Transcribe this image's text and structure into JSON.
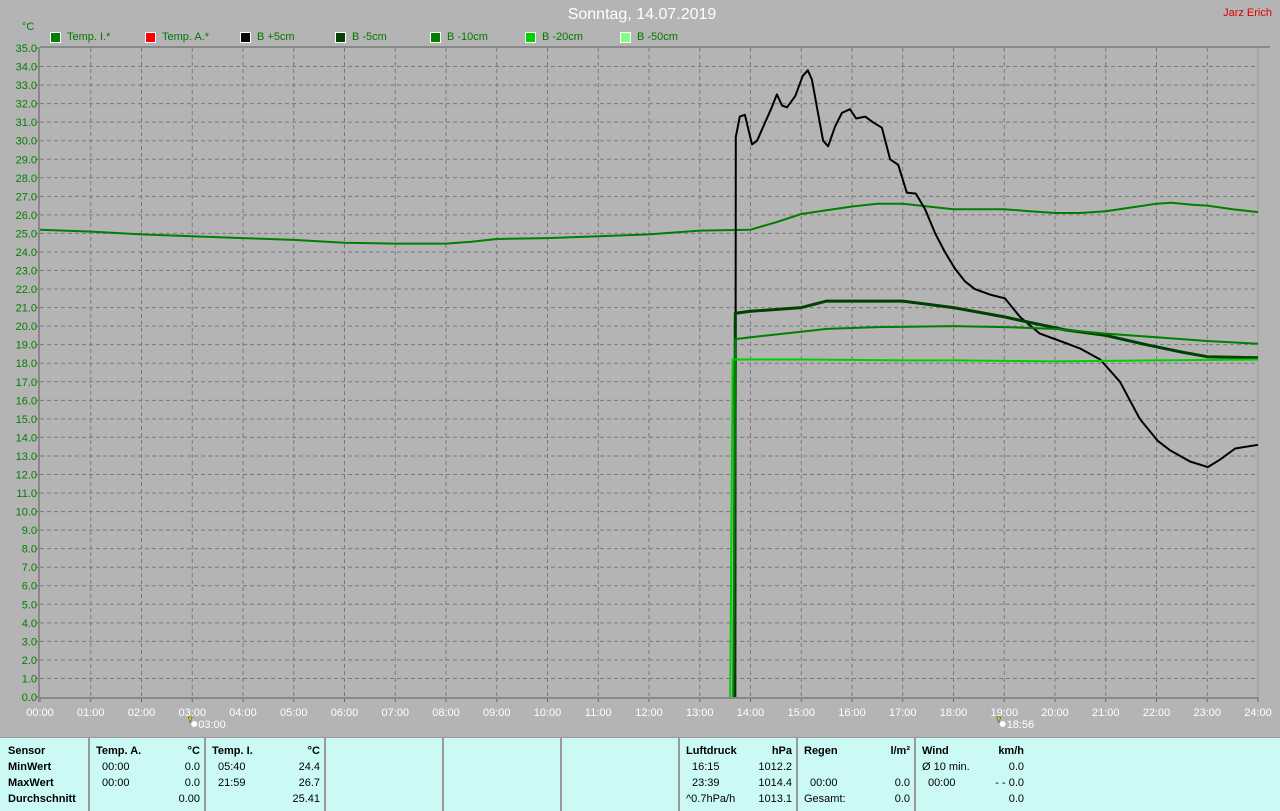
{
  "header": {
    "title": "Sonntag, 14.07.2019",
    "author": "Jarz Erich"
  },
  "legend": [
    {
      "label": "Temp. I.*",
      "color": "#007f00"
    },
    {
      "label": "Temp. A.*",
      "color": "#ff0000"
    },
    {
      "label": "B +5cm",
      "color": "#000000"
    },
    {
      "label": "B -5cm",
      "color": "#004000"
    },
    {
      "label": "B -10cm",
      "color": "#007f00"
    },
    {
      "label": "B -20cm",
      "color": "#00d000"
    },
    {
      "label": "B -50cm",
      "color": "#80ff80"
    }
  ],
  "chart_data": {
    "type": "line",
    "ylabel": "°C",
    "xlim": [
      0,
      24
    ],
    "ylim": [
      0,
      35
    ],
    "grid": true,
    "x_ticks": [
      "00:00",
      "01:00",
      "02:00",
      "03:00",
      "04:00",
      "05:00",
      "06:00",
      "07:00",
      "08:00",
      "09:00",
      "10:00",
      "11:00",
      "12:00",
      "13:00",
      "14:00",
      "15:00",
      "16:00",
      "17:00",
      "18:00",
      "19:00",
      "20:00",
      "21:00",
      "22:00",
      "23:00",
      "24:00"
    ],
    "y_ticks": [
      "0.0",
      "1.0",
      "2.0",
      "3.0",
      "4.0",
      "5.0",
      "6.0",
      "7.0",
      "8.0",
      "9.0",
      "10.0",
      "11.0",
      "12.0",
      "13.0",
      "14.0",
      "15.0",
      "16.0",
      "17.0",
      "18.0",
      "19.0",
      "20.0",
      "21.0",
      "22.0",
      "23.0",
      "24.0",
      "25.0",
      "26.0",
      "27.0",
      "28.0",
      "29.0",
      "30.0",
      "31.0",
      "32.0",
      "33.0",
      "34.0",
      "35.0"
    ],
    "annotations": [
      {
        "label": "03:00",
        "x": 3,
        "icon": "sunrise-icon"
      },
      {
        "label": "18:56",
        "x": 18.93,
        "icon": "sunset-icon"
      }
    ],
    "series": [
      {
        "name": "Temp. I.*",
        "color": "#007f00",
        "x": [
          0,
          1,
          2,
          3,
          4,
          5,
          6,
          7,
          8,
          8.5,
          9,
          10,
          11,
          12,
          13,
          14,
          14.5,
          15,
          15.5,
          16,
          16.5,
          17,
          17.5,
          18,
          18.5,
          19,
          19.5,
          20,
          20.5,
          21,
          21.5,
          22,
          22.3,
          22.7,
          23,
          23.5,
          24
        ],
        "y": [
          25.2,
          25.1,
          24.95,
          24.85,
          24.75,
          24.65,
          24.5,
          24.45,
          24.45,
          24.55,
          24.7,
          24.75,
          24.85,
          24.95,
          25.15,
          25.2,
          25.6,
          26.05,
          26.25,
          26.45,
          26.6,
          26.6,
          26.45,
          26.3,
          26.3,
          26.3,
          26.2,
          26.1,
          26.1,
          26.2,
          26.4,
          26.6,
          26.65,
          26.55,
          26.5,
          26.3,
          26.15
        ]
      },
      {
        "name": "B +5cm",
        "color": "#000000",
        "x": [
          13.7,
          13.71,
          13.79,
          13.89,
          14.03,
          14.13,
          14.29,
          14.42,
          14.52,
          14.62,
          14.72,
          14.88,
          15.03,
          15.13,
          15.21,
          15.33,
          15.43,
          15.53,
          15.67,
          15.8,
          15.96,
          16.08,
          16.26,
          16.41,
          16.59,
          16.75,
          16.91,
          17.08,
          17.26,
          17.44,
          17.64,
          17.83,
          18.03,
          18.23,
          18.42,
          18.72,
          19.01,
          19.31,
          19.7,
          20.1,
          20.49,
          20.89,
          21.28,
          21.67,
          22.03,
          22.27,
          22.66,
          23.01,
          23.25,
          23.55,
          24
        ],
        "y": [
          0,
          30.2,
          31.3,
          31.4,
          29.8,
          30.0,
          31.0,
          31.8,
          32.5,
          31.9,
          31.8,
          32.4,
          33.5,
          33.8,
          33.3,
          31.5,
          30.0,
          29.7,
          30.8,
          31.5,
          31.7,
          31.2,
          31.3,
          31.0,
          30.7,
          29.0,
          28.7,
          27.2,
          27.15,
          26.3,
          25.0,
          24.0,
          23.1,
          22.4,
          22.0,
          21.7,
          21.5,
          20.5,
          19.6,
          19.2,
          18.8,
          18.2,
          17.0,
          15.0,
          13.8,
          13.3,
          12.7,
          12.4,
          12.8,
          13.4,
          13.6
        ]
      },
      {
        "name": "B -5cm",
        "color": "#004000",
        "x": [
          13.68,
          13.7,
          14,
          15,
          15.5,
          17,
          18,
          19,
          19.5,
          20.2,
          21,
          21.8,
          22.5,
          23,
          24
        ],
        "y": [
          0,
          20.7,
          20.8,
          21.0,
          21.35,
          21.35,
          21.0,
          20.5,
          20.2,
          19.8,
          19.5,
          19.0,
          18.6,
          18.35,
          18.3
        ]
      },
      {
        "name": "B -10cm",
        "color": "#007f00",
        "x": [
          13.66,
          13.7,
          14,
          15,
          15.5,
          16.5,
          18,
          19,
          20,
          21,
          22,
          23,
          24
        ],
        "y": [
          0,
          19.3,
          19.4,
          19.7,
          19.85,
          19.95,
          20.0,
          19.95,
          19.85,
          19.6,
          19.4,
          19.2,
          19.05
        ]
      },
      {
        "name": "B -20cm",
        "color": "#00d000",
        "x": [
          13.6,
          13.65,
          15,
          17,
          18,
          20,
          22,
          24
        ],
        "y": [
          0,
          18.2,
          18.2,
          18.15,
          18.15,
          18.1,
          18.15,
          18.2
        ]
      }
    ]
  },
  "stats": {
    "sensor": {
      "header": "Sensor",
      "rows": [
        "MinWert",
        "MaxWert",
        "Durchschnitt"
      ]
    },
    "temp_a": {
      "header": "Temp. A.",
      "unit": "°C",
      "min_time": "00:00",
      "min": "0.0",
      "max_time": "00:00",
      "max": "0.0",
      "avg": "0.00"
    },
    "temp_i": {
      "header": "Temp. I.",
      "unit": "°C",
      "min_time": "05:40",
      "min": "24.4",
      "max_time": "21:59",
      "max": "26.7",
      "avg": "25.41"
    },
    "pressure": {
      "header": "Luftdruck",
      "unit": "hPa",
      "min_time": "16:15",
      "min": "1012.2",
      "max_time": "23:39",
      "max": "1014.4",
      "trend": "^0.7hPa/h",
      "current": "1013.1"
    },
    "rain": {
      "header": "Regen",
      "unit": "l/m²",
      "time": "00:00",
      "value": "0.0",
      "total_label": "Gesamt:",
      "total": "0.0"
    },
    "wind": {
      "header": "Wind",
      "unit": "km/h",
      "avg_label": "Ø 10 min.",
      "avg": "0.0",
      "time": "00:00",
      "max": "- - 0.0",
      "value": "0.0"
    }
  }
}
